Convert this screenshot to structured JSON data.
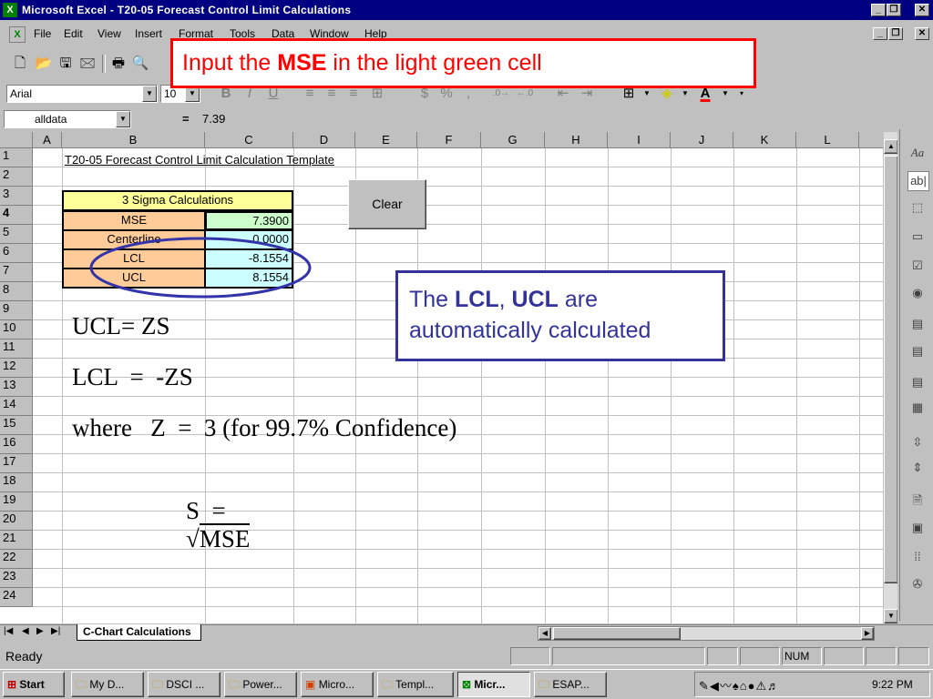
{
  "window": {
    "title": "Microsoft Excel - T20-05 Forecast Control Limit Calculations"
  },
  "menu": {
    "items": [
      "File",
      "Edit",
      "View",
      "Insert",
      "Format",
      "Tools",
      "Data",
      "Window",
      "Help"
    ]
  },
  "format_bar": {
    "font": "Arial",
    "size": "10"
  },
  "formula_bar": {
    "name_box": "alldata",
    "equals": "=",
    "value": "7.39"
  },
  "columns": [
    "A",
    "B",
    "C",
    "D",
    "E",
    "F",
    "G",
    "H",
    "I",
    "J",
    "K",
    "L"
  ],
  "rows": [
    "1",
    "2",
    "3",
    "4",
    "5",
    "6",
    "7",
    "8",
    "9",
    "10",
    "11",
    "12",
    "13",
    "14",
    "15",
    "16",
    "17",
    "18",
    "19",
    "20",
    "21",
    "22",
    "23",
    "24"
  ],
  "sheet": {
    "title": "T20-05 Forecast Control Limit Calculation Template",
    "table_header": "3 Sigma Calculations",
    "labels": [
      "MSE",
      "Centerline",
      "LCL",
      "UCL"
    ],
    "values": [
      "7.3900",
      "0.0000",
      "-8.1554",
      "8.1554"
    ],
    "clear_button": "Clear",
    "formulas": {
      "ucl": "UCL= ZS",
      "lcl": "LCL  =  -ZS",
      "where": "where   Z  =  3 (for 99.7% Confidence)",
      "s_lhs": "S  =",
      "sqrt_symbol": "√",
      "s_rhs": "MSE"
    }
  },
  "callouts": {
    "top_prefix": "Input the ",
    "top_bold": "MSE",
    "top_suffix": " in the light green cell",
    "box_text_1": "The ",
    "box_bold_1": "LCL",
    "box_text_2": ", ",
    "box_bold_2": "UCL",
    "box_text_3": " are",
    "box_line_2": "automatically calculated"
  },
  "sheet_tab": "C-Chart Calculations",
  "status": {
    "ready": "Ready",
    "num": "NUM"
  },
  "taskbar": {
    "start": "Start",
    "buttons": [
      "My D...",
      "DSCI ...",
      "Power...",
      "Micro...",
      "Templ...",
      "Micr...",
      "ESAP..."
    ],
    "clock": "9:22 PM"
  },
  "colors": {
    "title_bar": "#000080",
    "mse_cell": "#ccffcc",
    "calc_cell": "#ccffff",
    "label_cell": "#ffcc99",
    "header_cell": "#ffff99",
    "callout_red": "#ff0000",
    "callout_blue": "#333399",
    "ellipse": "#3333aa"
  }
}
